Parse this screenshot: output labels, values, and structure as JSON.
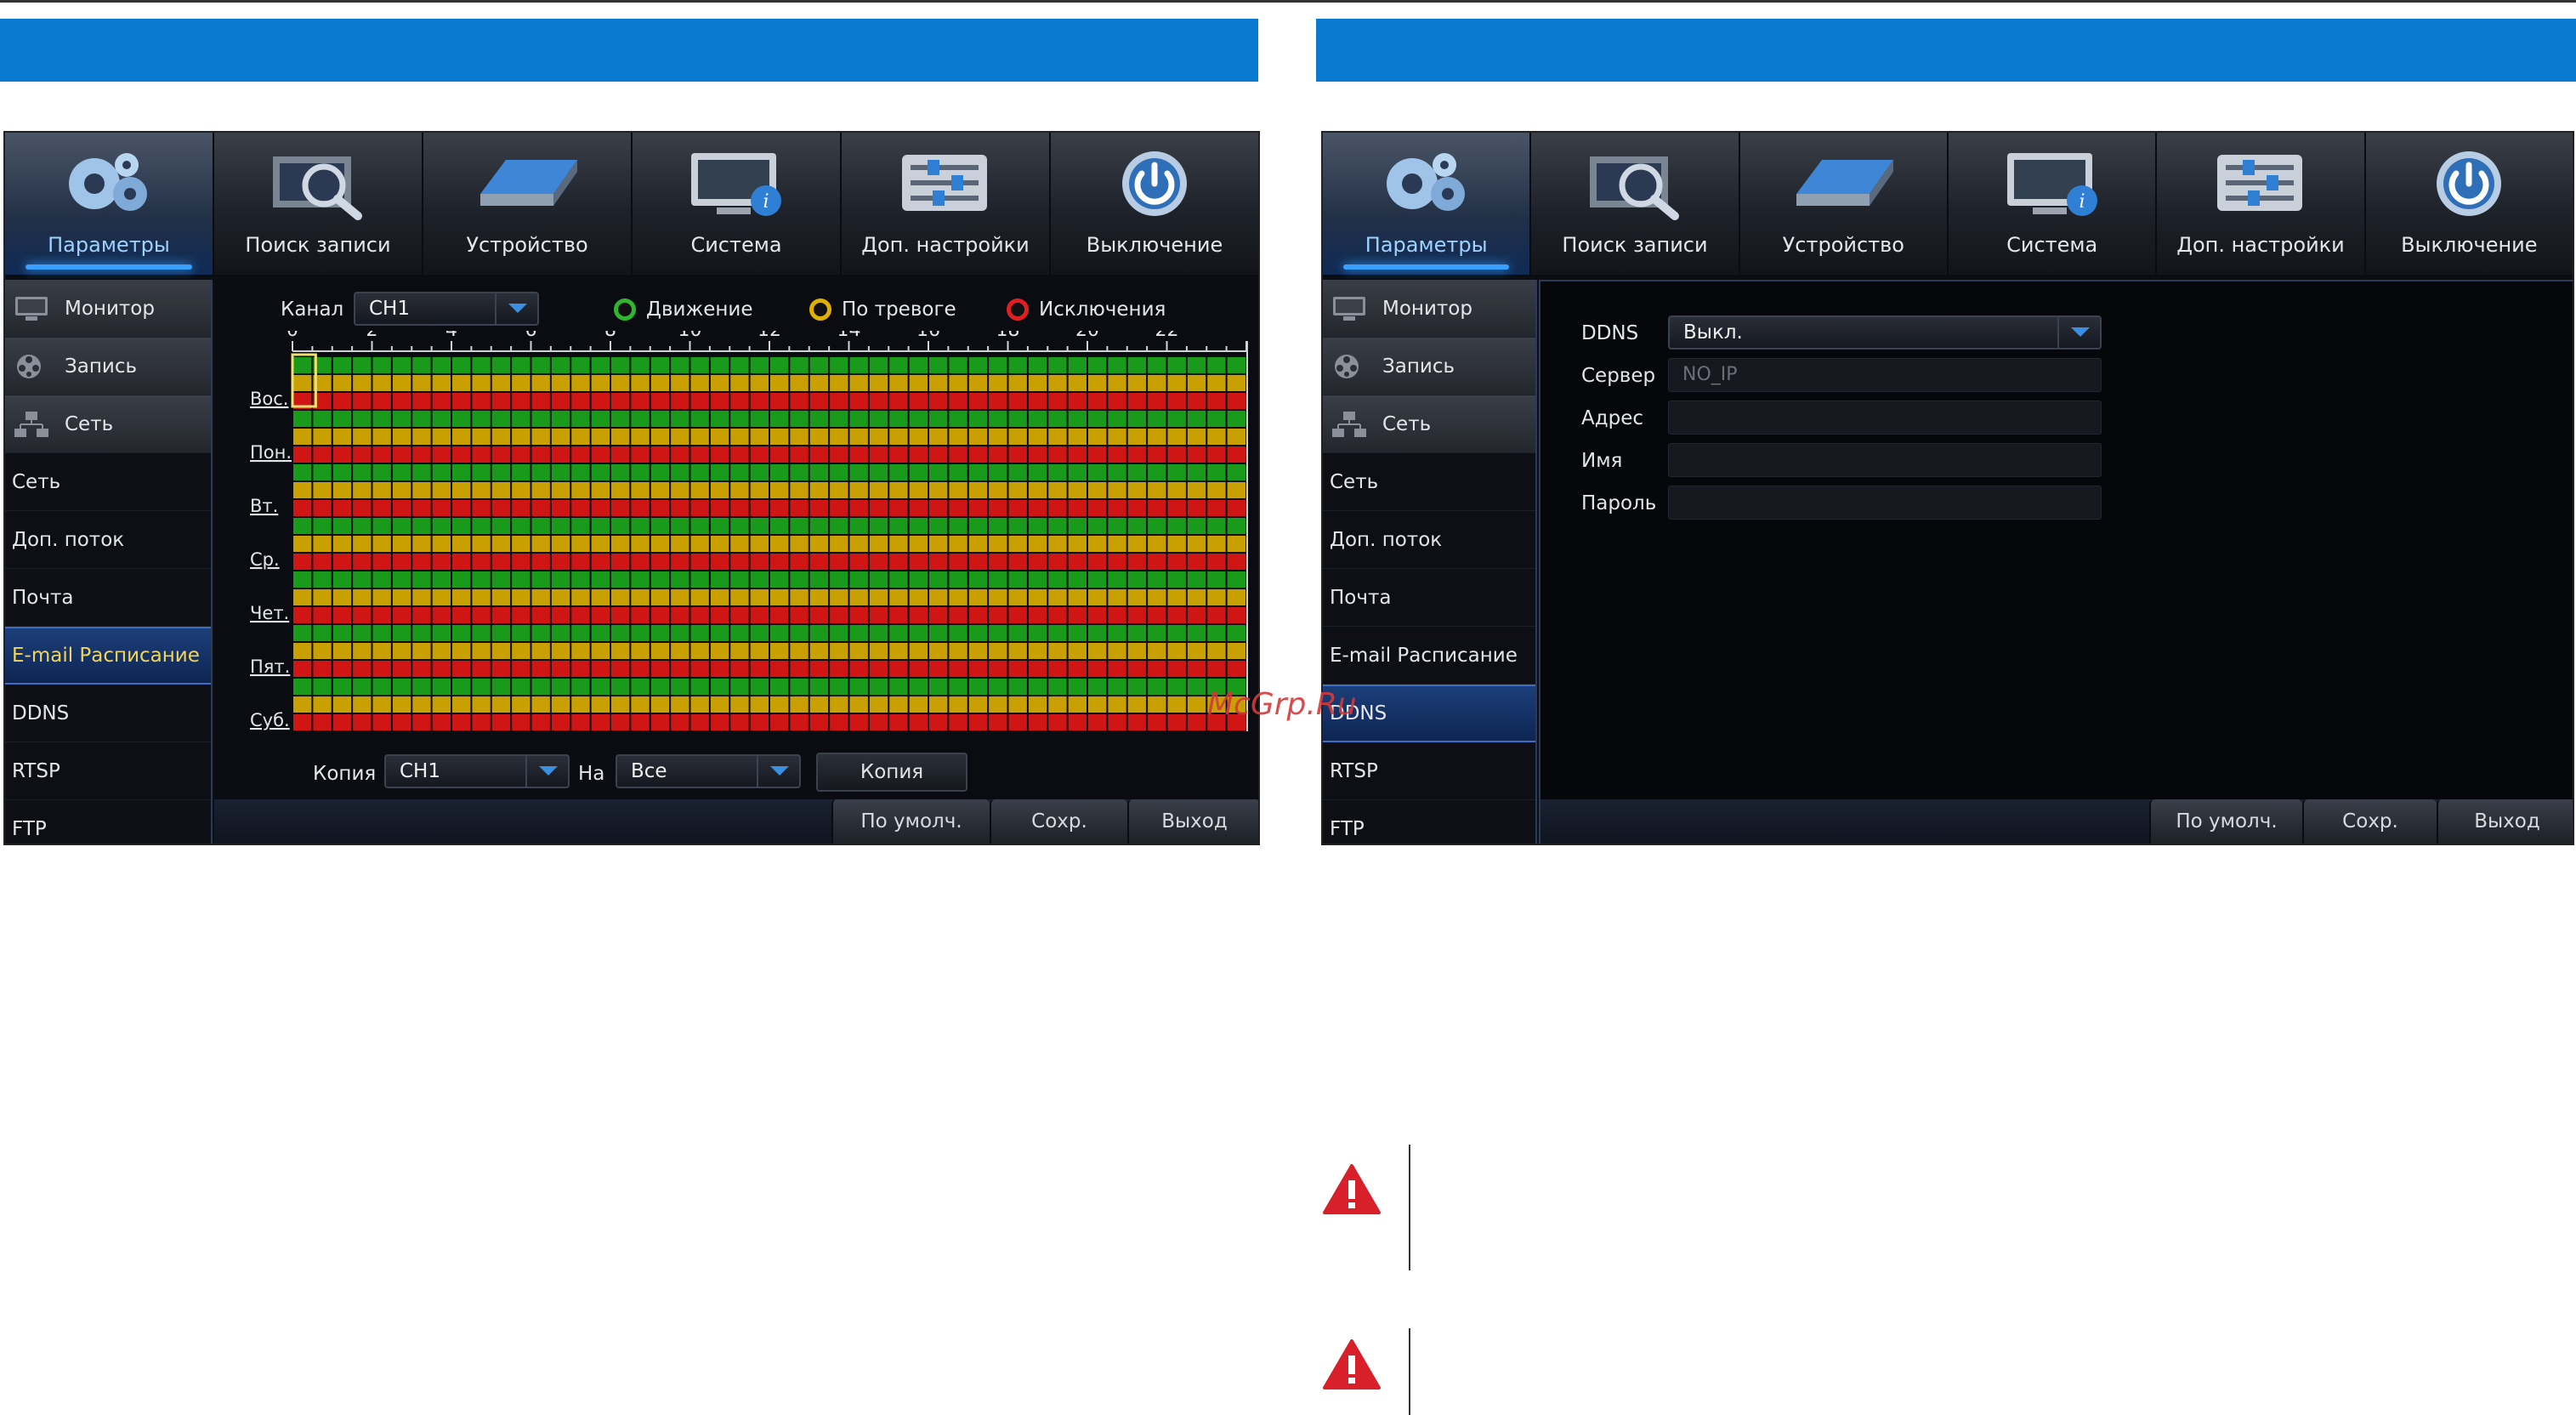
{
  "top_menu": [
    {
      "label": "Параметры",
      "icon": "gears-icon",
      "active": true
    },
    {
      "label": "Поиск записи",
      "icon": "search-record-icon"
    },
    {
      "label": "Устройство",
      "icon": "hard-drive-icon"
    },
    {
      "label": "Система",
      "icon": "system-info-icon"
    },
    {
      "label": "Доп. настройки",
      "icon": "sliders-icon"
    },
    {
      "label": "Выключение",
      "icon": "power-icon"
    }
  ],
  "sidebar_groups": {
    "monitor": "Монитор",
    "record": "Запись",
    "network": "Сеть"
  },
  "sidebar_items": [
    "Сеть",
    "Доп. поток",
    "Почта",
    "E-mail Расписание",
    "DDNS",
    "RTSP",
    "FTP"
  ],
  "screen1": {
    "channel_label": "Канал",
    "channel_value": "CH1",
    "legend": [
      {
        "label": "Движение",
        "color": "#2fb52f"
      },
      {
        "label": "По тревоге",
        "color": "#e0b000"
      },
      {
        "label": "Исключения",
        "color": "#e02020"
      }
    ],
    "hours": [
      "0",
      "2",
      "4",
      "6",
      "8",
      "10",
      "12",
      "14",
      "16",
      "18",
      "20",
      "22"
    ],
    "days": [
      "Вос.",
      "Пон.",
      "Вт.",
      "Ср.",
      "Чет.",
      "Пят.",
      "Суб."
    ],
    "copy_label": "Копия",
    "copy_value": "CH1",
    "to_label": "На",
    "to_value": "Все",
    "copy_button": "Копия",
    "selected_sidebar": "E-mail Расписание"
  },
  "screen2": {
    "ddns_label": "DDNS",
    "ddns_value": "Выкл.",
    "server_label": "Сервер",
    "server_value": "NO_IP",
    "address_label": "Адрес",
    "name_label": "Имя",
    "password_label": "Пароль",
    "selected_sidebar": "DDNS"
  },
  "buttons": {
    "default": "По умолч.",
    "save": "Сохр.",
    "exit": "Выход"
  },
  "watermark": "McGrp.Ru",
  "colors": {
    "blue_bar": "#0a7ad1",
    "motion": "#1a9a1a",
    "alarm": "#c8a000",
    "exception": "#d01515"
  }
}
